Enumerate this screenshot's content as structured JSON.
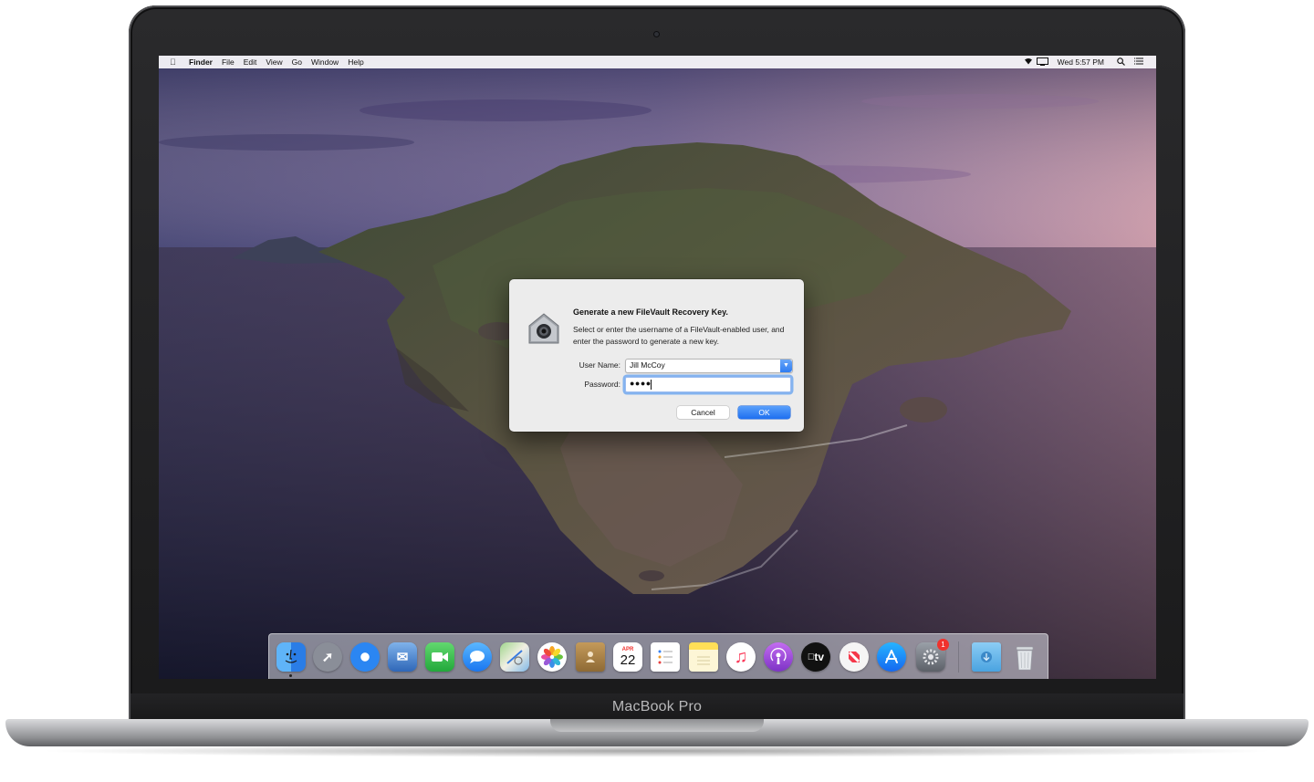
{
  "device": {
    "brand": "MacBook Pro"
  },
  "menubar": {
    "apple_icon": "apple-icon",
    "app_name": "Finder",
    "items": [
      "File",
      "Edit",
      "View",
      "Go",
      "Window",
      "Help"
    ],
    "clock": "Wed 5:57 PM",
    "status_icons": [
      "wifi-icon",
      "display-icon",
      "search-icon",
      "list-icon"
    ]
  },
  "dialog": {
    "icon": "lock-padlock-icon",
    "title": "Generate a new FileVault Recovery Key.",
    "message": "Select or enter the username of a FileVault-enabled user, and enter the password to generate a new key.",
    "user_label": "User Name:",
    "user_value": "Jill McCoy",
    "password_label": "Password:",
    "password_value": "●●●●",
    "cancel_label": "Cancel",
    "ok_label": "OK"
  },
  "dock": {
    "items": [
      {
        "name": "finder",
        "icon": "finder-icon",
        "color": "#2f8cf0"
      },
      {
        "name": "launchpad",
        "icon": "rocket-icon",
        "color": "#7b7f89"
      },
      {
        "name": "safari",
        "icon": "compass-icon",
        "color": "#1f7af0"
      },
      {
        "name": "mail",
        "icon": "eagle-stamp-icon",
        "color": "#3a78c8"
      },
      {
        "name": "facetime",
        "icon": "video-camera-icon",
        "color": "#2dbf4a"
      },
      {
        "name": "messages",
        "icon": "speech-bubble-icon",
        "color": "#2b8cf5"
      },
      {
        "name": "maps",
        "icon": "map-icon",
        "color": "#78c46a"
      },
      {
        "name": "photos",
        "icon": "flower-icon",
        "color": "#f0f0f0"
      },
      {
        "name": "contacts",
        "icon": "contacts-book-icon",
        "color": "#b0884f"
      },
      {
        "name": "calendar",
        "icon": "calendar-icon",
        "color": "#ffffff",
        "month": "APR",
        "day": "22"
      },
      {
        "name": "reminders",
        "icon": "checklist-icon",
        "color": "#ffffff"
      },
      {
        "name": "notes",
        "icon": "notepad-icon",
        "color": "#ffd84a"
      },
      {
        "name": "music",
        "icon": "music-note-icon",
        "color": "#fb4a5f"
      },
      {
        "name": "podcasts",
        "icon": "podcast-icon",
        "color": "#9a49d6"
      },
      {
        "name": "tv",
        "icon": "apple-tv-icon",
        "color": "#111111",
        "label": "tv"
      },
      {
        "name": "news",
        "icon": "news-icon",
        "color": "#f3f3f3"
      },
      {
        "name": "app-store",
        "icon": "app-store-icon",
        "color": "#1a8cf5"
      },
      {
        "name": "system-preferences",
        "icon": "gear-icon",
        "color": "#8e8e93",
        "badge": "1"
      },
      {
        "name": "downloads",
        "icon": "downloads-folder-icon",
        "color": "#6bb6ea"
      },
      {
        "name": "trash",
        "icon": "trash-icon",
        "color": "#dfe2e6"
      }
    ]
  }
}
